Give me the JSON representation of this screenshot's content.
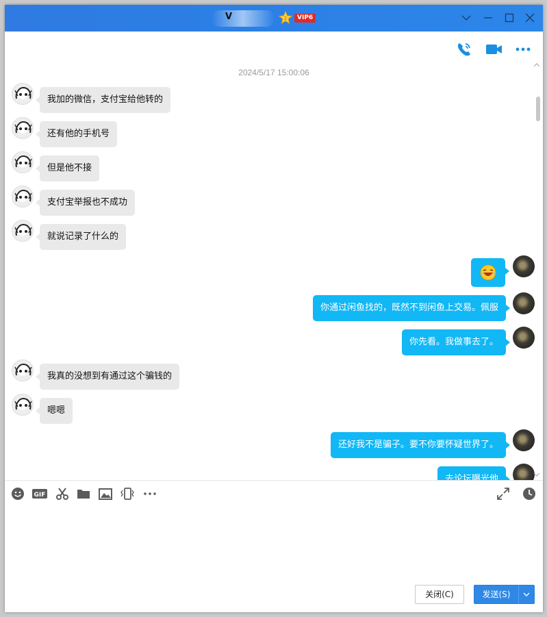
{
  "window": {
    "title_name": "V",
    "vip_label": "VIP6",
    "accent_color": "#2f7be2",
    "bubble_self_color": "#12b7f5",
    "bubble_other_color": "#e9e9e9"
  },
  "header_actions": [
    {
      "name": "voice-call-icon"
    },
    {
      "name": "video-call-icon"
    },
    {
      "name": "more-icon"
    }
  ],
  "chat": {
    "timestamp": "2024/5/17 15:00:06",
    "messages": [
      {
        "side": "left",
        "text": "我加的微信，支付宝给他转的"
      },
      {
        "side": "left",
        "text": "还有他的手机号"
      },
      {
        "side": "left",
        "text": "但是他不接"
      },
      {
        "side": "left",
        "text": "支付宝举报也不成功"
      },
      {
        "side": "left",
        "text": "就说记录了什么的"
      },
      {
        "side": "right",
        "text": "",
        "emoji": "laughing-face"
      },
      {
        "side": "right",
        "text": "你通过闲鱼找的，既然不到闲鱼上交易。佩服"
      },
      {
        "side": "right",
        "text": "你先看。我做事去了。"
      },
      {
        "side": "left",
        "text": "我真的没想到有通过这个骗钱的"
      },
      {
        "side": "left",
        "text": "嗯嗯"
      },
      {
        "side": "right",
        "text": "还好我不是骗子。要不你要怀疑世界了。"
      },
      {
        "side": "right",
        "text": "去论坛曝光他"
      }
    ]
  },
  "input_toolbar": [
    {
      "name": "emoji-icon"
    },
    {
      "name": "gif-icon",
      "label": "GIF"
    },
    {
      "name": "scissors-icon"
    },
    {
      "name": "folder-icon"
    },
    {
      "name": "image-icon"
    },
    {
      "name": "shake-icon"
    },
    {
      "name": "more-tools-icon"
    },
    {
      "name": "expand-icon"
    },
    {
      "name": "history-icon"
    }
  ],
  "buttons": {
    "close_label": "关闭(C)",
    "send_label": "发送(S)"
  }
}
